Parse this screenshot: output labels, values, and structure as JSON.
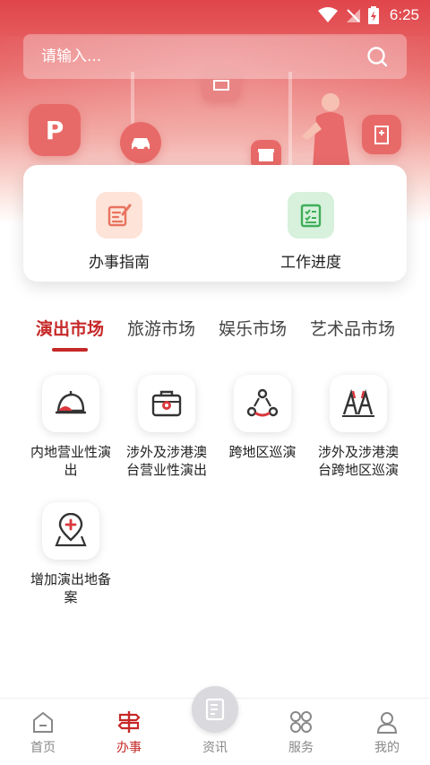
{
  "status_bar": {
    "time": "6:25"
  },
  "search": {
    "placeholder": "请输入..."
  },
  "hero": {
    "badge_p": "P"
  },
  "quick_actions": [
    {
      "label": "办事指南",
      "icon": "edit-document-icon",
      "color": "#e8735f"
    },
    {
      "label": "工作进度",
      "icon": "checklist-icon",
      "color": "#3fae5a"
    }
  ],
  "tabs": [
    "演出市场",
    "旅游市场",
    "娱乐市场",
    "艺术品市场"
  ],
  "active_tab": "演出市场",
  "services": [
    {
      "label": "内地营业性演出",
      "icon": "service-bell-icon"
    },
    {
      "label": "涉外及涉港澳台营业性演出",
      "icon": "briefcase-icon"
    },
    {
      "label": "跨地区巡演",
      "icon": "cycle-nodes-icon"
    },
    {
      "label": "涉外及涉港澳台跨地区巡演",
      "icon": "stage-performers-icon"
    },
    {
      "label": "增加演出地备案",
      "icon": "location-add-icon"
    }
  ],
  "bottom_nav": [
    {
      "label": "首页",
      "icon": "home-icon"
    },
    {
      "label": "办事",
      "icon": "signpost-icon"
    },
    {
      "label": "资讯",
      "icon": "news-icon"
    },
    {
      "label": "服务",
      "icon": "grid-icon"
    },
    {
      "label": "我的",
      "icon": "profile-icon"
    }
  ],
  "active_nav": "办事",
  "colors": {
    "accent": "#c62828",
    "hero": "#e0454b"
  }
}
